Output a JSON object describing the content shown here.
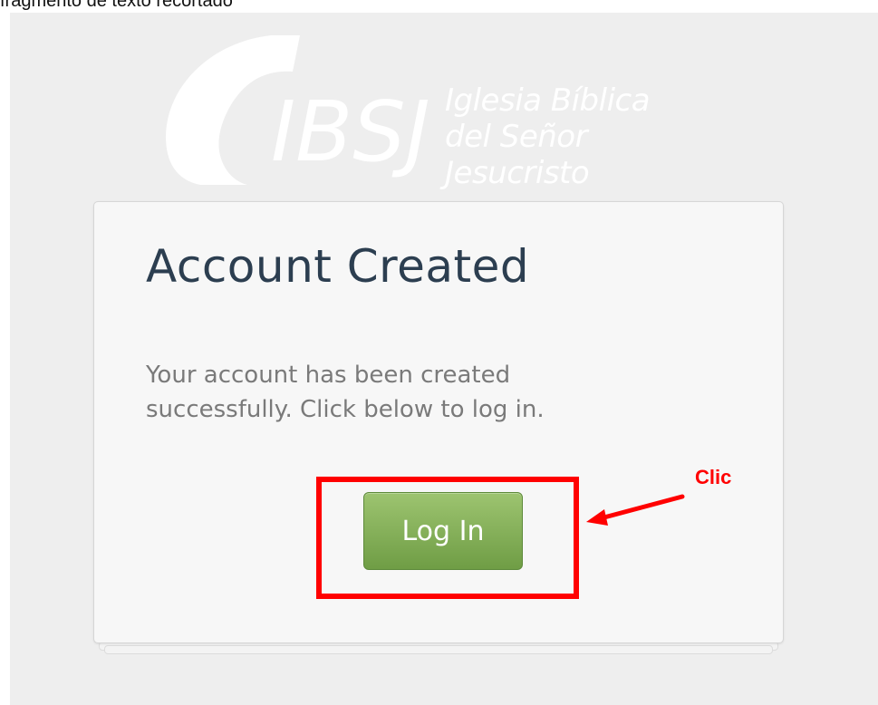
{
  "top_strip": {
    "text": "fragmento de texto recortado"
  },
  "logo": {
    "abbrev": "IBSJ",
    "name_line1": "Iglesia Bíblica",
    "name_line2": "del Señor Jesucristo"
  },
  "card": {
    "title": "Account Created",
    "message": "Your account has been created successfully. Click below to log in.",
    "button_label": "Log In"
  },
  "annotation": {
    "label": "Clic",
    "color": "#ff0000"
  },
  "colors": {
    "page_bg": "#eeeeee",
    "card_bg": "#f7f7f7",
    "title": "#2c3e50",
    "button": "#7aa84d"
  }
}
